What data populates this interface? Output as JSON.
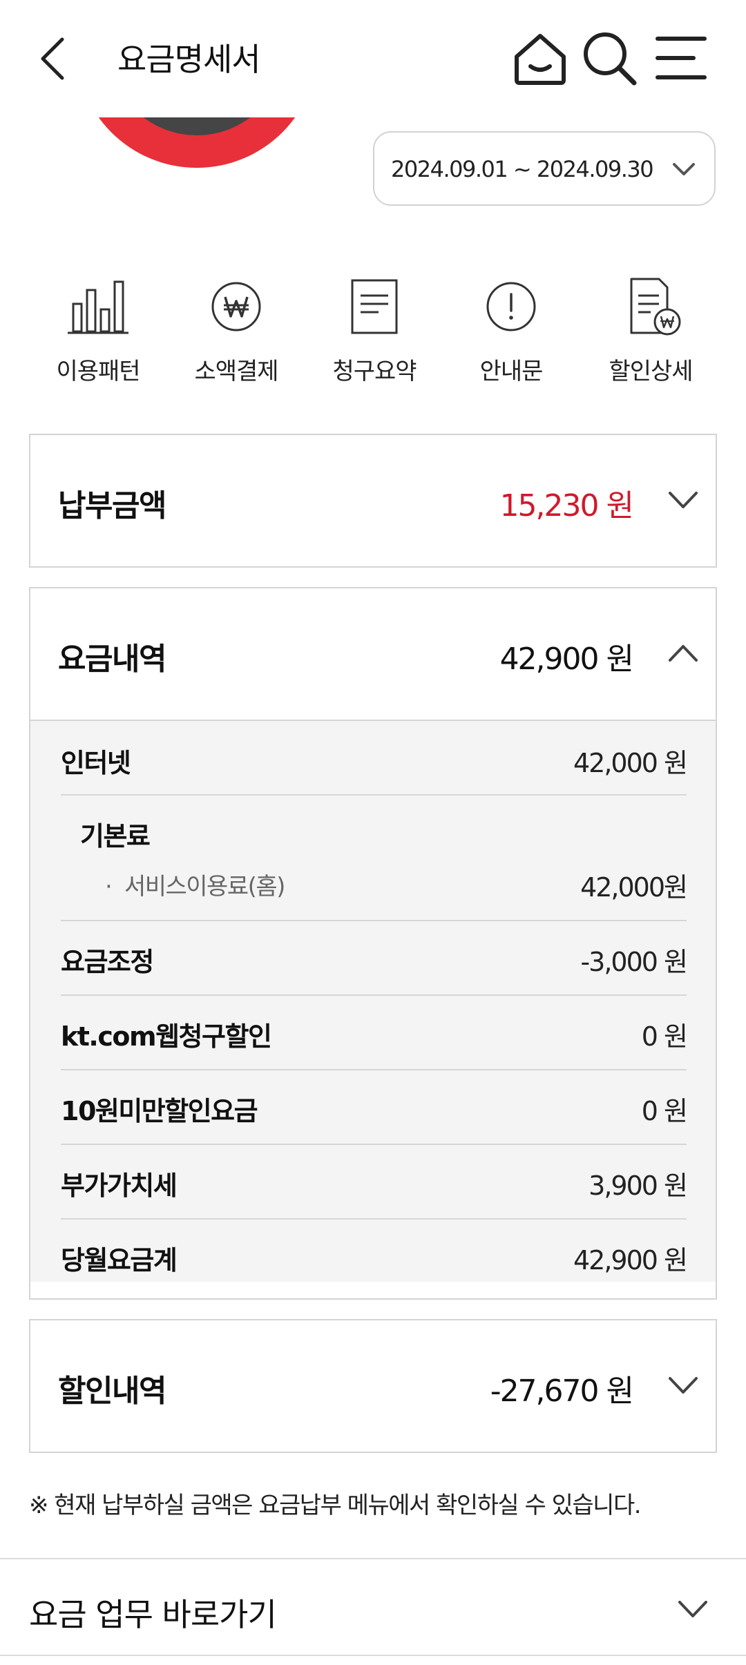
{
  "header": {
    "title": "요금명세서"
  },
  "period": {
    "range": "2024.09.01 ~ 2024.09.30"
  },
  "quick_menu": [
    {
      "label": "이용패턴",
      "icon": "bar-chart-icon"
    },
    {
      "label": "소액결제",
      "icon": "won-coin-icon"
    },
    {
      "label": "청구요약",
      "icon": "document-icon"
    },
    {
      "label": "안내문",
      "icon": "notice-icon"
    },
    {
      "label": "할인상세",
      "icon": "discount-document-icon"
    }
  ],
  "payment": {
    "title": "납부금액",
    "amount": "15,230 원"
  },
  "charges": {
    "title": "요금내역",
    "amount": "42,900 원",
    "rows": [
      {
        "label": "인터넷",
        "value": "42,000 원"
      },
      {
        "label": "기본료",
        "item": "서비스이용료(홈)",
        "value": "42,000원"
      },
      {
        "label": "요금조정",
        "value": "-3,000 원"
      },
      {
        "label": "kt.com웹청구할인",
        "value": "0 원"
      },
      {
        "label": "10원미만할인요금",
        "value": "0 원"
      },
      {
        "label": "부가가치세",
        "value": "3,900 원"
      },
      {
        "label": "당월요금계",
        "value": "42,900 원"
      }
    ]
  },
  "discounts": {
    "title": "할인내역",
    "amount": "-27,670 원"
  },
  "notice": "※ 현재 납부하실 금액은 요금납부 메뉴에서 확인하실 수 있습니다.",
  "shortcut": {
    "title": "요금 업무 바로가기"
  },
  "colors": {
    "accent_red": "#e8303a",
    "donut_dark": "#454545",
    "amount_red": "#d0192b"
  }
}
